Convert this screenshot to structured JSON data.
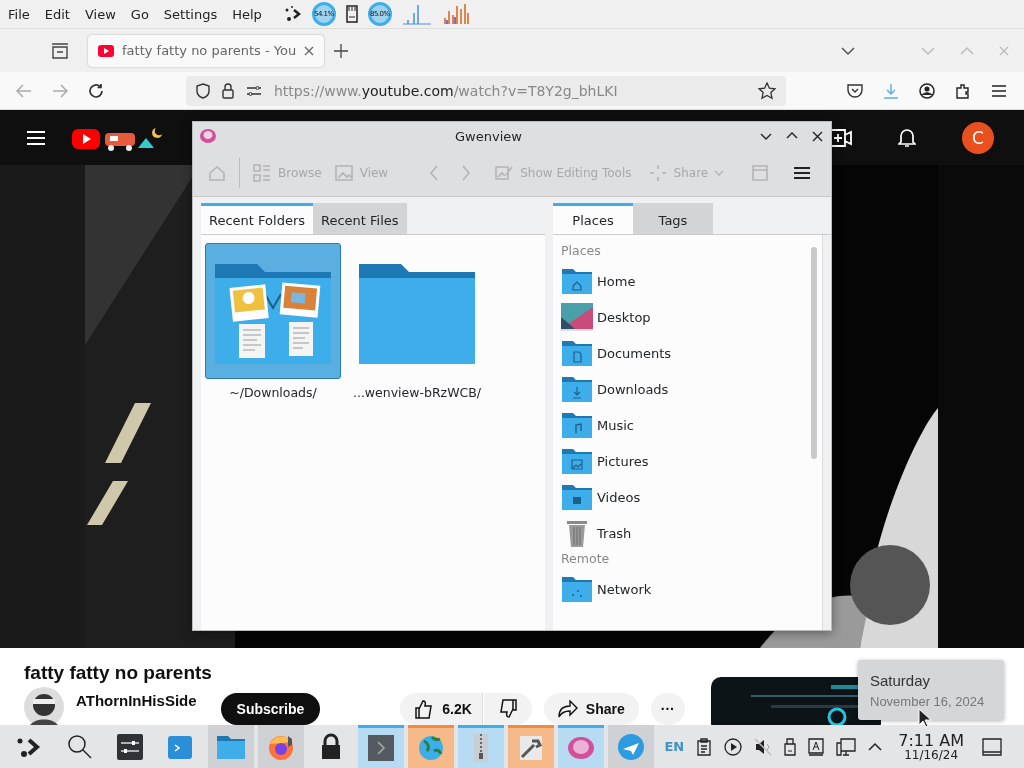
{
  "panel": {
    "menu": [
      "File",
      "Edit",
      "View",
      "Go",
      "Settings",
      "Help"
    ],
    "widgets": [
      {
        "kind": "gauge",
        "reading": "54.1%"
      },
      {
        "kind": "gauge",
        "reading": "85.0%"
      }
    ]
  },
  "browser": {
    "tab": {
      "title": "fatty fatty no parents - You",
      "selected": true
    },
    "url": [
      "https://www.",
      "youtube.com",
      "/watch?v=T8Y2g_bhLKI"
    ]
  },
  "youtube": {
    "avatar_letter": "C",
    "title": "fatty fatty no parents",
    "channel": "AThornInHisSide",
    "subscribe": "Subscribe",
    "likes": "6.2K",
    "share": "Share",
    "more": "···"
  },
  "gwenview": {
    "title": "Gwenview",
    "toolbar": [
      {
        "kind": "home",
        "disabled": true
      },
      {
        "kind": "browse",
        "label": "Browse",
        "disabled": true
      },
      {
        "kind": "view",
        "label": "View",
        "disabled": true
      },
      {
        "kind": "prev",
        "disabled": true
      },
      {
        "kind": "next",
        "disabled": true
      },
      {
        "kind": "edit",
        "label": "Show Editing Tools",
        "disabled": true
      },
      {
        "kind": "share",
        "label": "Share",
        "disabled": true
      },
      {
        "kind": "fullscreen",
        "disabled": true
      },
      {
        "kind": "menu",
        "disabled": false
      }
    ],
    "left_tabs": [
      {
        "label": "Recent Folders",
        "selected": true
      },
      {
        "label": "Recent Files",
        "selected": false
      }
    ],
    "folders": [
      {
        "label": "~/Downloads/",
        "kind": "thumbnails",
        "selected": true
      },
      {
        "label": "...wenview-bRzWCB/",
        "kind": "plain",
        "selected": false
      }
    ],
    "right_tabs": [
      {
        "label": "Places",
        "selected": true
      },
      {
        "label": "Tags",
        "selected": false
      }
    ],
    "sections": [
      {
        "heading": "Places",
        "items": [
          {
            "label": "Home",
            "kind": "home"
          },
          {
            "label": "Desktop",
            "kind": "desktop"
          },
          {
            "label": "Documents",
            "kind": "documents"
          },
          {
            "label": "Downloads",
            "kind": "downloads"
          },
          {
            "label": "Music",
            "kind": "music"
          },
          {
            "label": "Pictures",
            "kind": "pictures"
          },
          {
            "label": "Videos",
            "kind": "videos"
          },
          {
            "label": "Trash",
            "kind": "trash"
          }
        ]
      },
      {
        "heading": "Remote",
        "items": [
          {
            "label": "Network",
            "kind": "network"
          }
        ]
      }
    ]
  },
  "tooltip": {
    "day": "Saturday",
    "date": "November 16, 2024"
  },
  "taskbar": {
    "tasks": [
      {
        "kind": "launcher",
        "open": false,
        "active": false,
        "attention": false
      },
      {
        "kind": "search",
        "open": false,
        "active": false,
        "attention": false
      },
      {
        "kind": "mixer",
        "open": false,
        "active": false,
        "attention": false
      },
      {
        "kind": "terminal-blue",
        "open": false,
        "active": false,
        "attention": false
      },
      {
        "kind": "folder",
        "open": true,
        "active": false,
        "attention": false
      },
      {
        "kind": "firefox",
        "open": true,
        "active": false,
        "attention": false
      },
      {
        "kind": "lock",
        "open": false,
        "active": false,
        "attention": false
      },
      {
        "kind": "terminal",
        "open": true,
        "active": true,
        "attention": false
      },
      {
        "kind": "globe",
        "open": true,
        "active": false,
        "attention": true
      },
      {
        "kind": "archive",
        "open": true,
        "active": true,
        "attention": false
      },
      {
        "kind": "tool",
        "open": true,
        "active": false,
        "attention": true
      },
      {
        "kind": "viewer",
        "open": true,
        "active": true,
        "attention": false
      },
      {
        "kind": "plane",
        "open": true,
        "active": false,
        "attention": false
      }
    ],
    "language": "EN",
    "time": "7:11 AM",
    "date": "11/16/24"
  }
}
